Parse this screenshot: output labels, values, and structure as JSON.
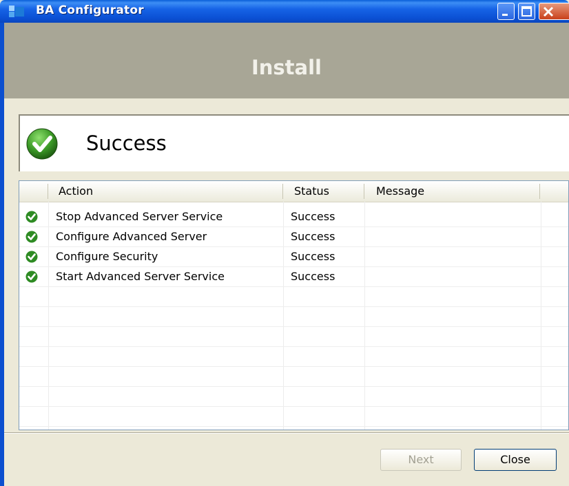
{
  "window": {
    "title": "BA Configurator"
  },
  "header": {
    "title": "Install"
  },
  "result": {
    "text": "Success",
    "icon": "check-circle-icon"
  },
  "table": {
    "columns": [
      "Action",
      "Status",
      "Message"
    ],
    "rows": [
      {
        "action": "Stop Advanced Server Service",
        "status": "Success",
        "message": ""
      },
      {
        "action": "Configure Advanced Server",
        "status": "Success",
        "message": ""
      },
      {
        "action": "Configure Security",
        "status": "Success",
        "message": ""
      },
      {
        "action": "Start Advanced Server Service",
        "status": "Success",
        "message": ""
      }
    ]
  },
  "buttons": {
    "next_label": "Next",
    "close_label": "Close"
  },
  "colors": {
    "titlebar": "#0b50d4",
    "header_band": "#a8a696",
    "success_green": "#2e8b23"
  }
}
